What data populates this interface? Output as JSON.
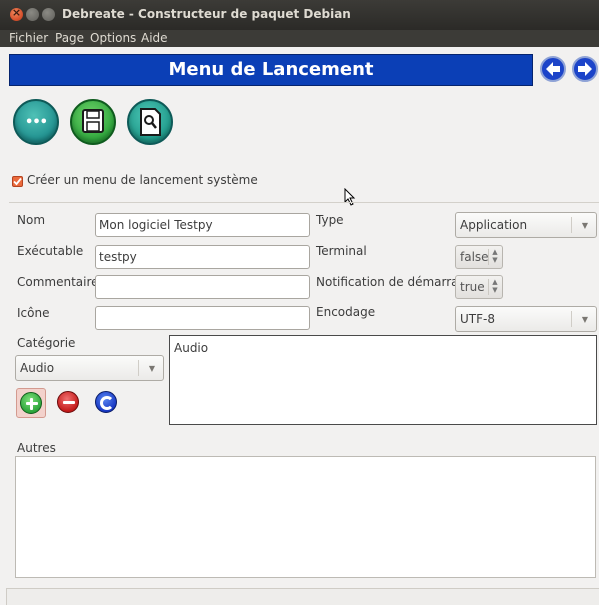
{
  "window": {
    "title": "Debreate - Constructeur de paquet Debian",
    "close_glyph": "×"
  },
  "menubar": [
    "Fichier",
    "Page",
    "Options",
    "Aide"
  ],
  "header": {
    "title": "Menu de Lancement",
    "back_icon": "arrow-left-icon",
    "forward_icon": "arrow-right-icon",
    "color": "#0b3fb6"
  },
  "toolbar": {
    "icons": [
      "more-options-icon",
      "save-icon",
      "preview-icon"
    ],
    "more_glyph": "•••"
  },
  "launcher": {
    "checkbox_label": "Créer un menu de lancement système",
    "checked": true
  },
  "form": {
    "name_label": "Nom",
    "name_value": "Mon logiciel Testpy",
    "exec_label": "Exécutable",
    "exec_value": "testpy",
    "comment_label": "Commentaires",
    "comment_value": "",
    "icon_label": "Icône",
    "icon_value": "",
    "type_label": "Type",
    "type_value": "Application",
    "terminal_label": "Terminal",
    "terminal_value": "false",
    "notify_label": "Notification de démarrage",
    "notify_value": "true",
    "encoding_label": "Encodage",
    "encoding_value": "UTF-8"
  },
  "category": {
    "label": "Catégorie",
    "selected": "Audio",
    "list": [
      "Audio"
    ]
  },
  "other": {
    "label": "Autres",
    "value": ""
  }
}
